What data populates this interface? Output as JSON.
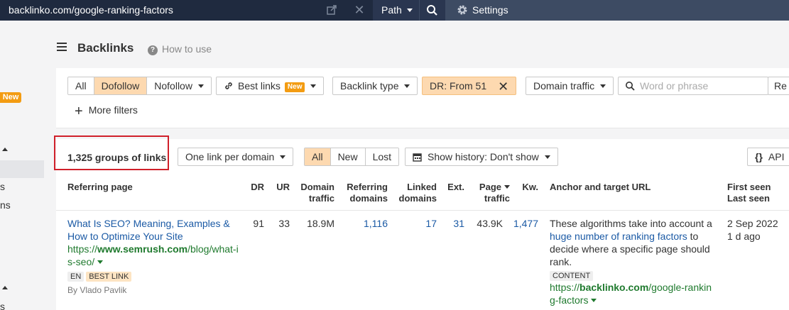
{
  "topbar": {
    "url": "backlinko.com/google-ranking-factors",
    "mode": "Path",
    "settings": "Settings",
    "icons": [
      "external-link-icon",
      "clear-icon",
      "search-icon",
      "gear-icon"
    ]
  },
  "sidebar": {
    "new_badge": "New",
    "item_a": "s",
    "item_b": "ns",
    "item_c": "s"
  },
  "header": {
    "title": "Backlinks",
    "how_to": "How to use",
    "help_glyph": "?"
  },
  "filters": {
    "all": "All",
    "dofollow": "Dofollow",
    "nofollow": "Nofollow",
    "best_links": "Best links",
    "best_links_badge": "New",
    "backlink_type": "Backlink type",
    "dr": "DR: From 51",
    "domain_traffic": "Domain traffic",
    "search_placeholder": "Word or phrase",
    "search_mode": "Re",
    "more_filters": "More filters"
  },
  "results": {
    "count": "1,325 groups of links",
    "grouping": "One link per domain",
    "tabs": [
      "All",
      "New",
      "Lost"
    ],
    "active_tab": "All",
    "history": "Show history: Don't show",
    "api": "{}",
    "api_label": "API"
  },
  "table": {
    "headers": {
      "referring_page": "Referring page",
      "dr": "DR",
      "ur": "UR",
      "domain_traffic_1": "Domain",
      "domain_traffic_2": "traffic",
      "referring_domains_1": "Referring",
      "referring_domains_2": "domains",
      "linked_domains_1": "Linked",
      "linked_domains_2": "domains",
      "ext": "Ext.",
      "page_traffic_1": "Page",
      "page_traffic_2": "traffic",
      "kw": "Kw.",
      "anchor": "Anchor and target URL",
      "first_seen": "First seen",
      "last_seen": "Last seen"
    },
    "rows": [
      {
        "title_line1": "What Is SEO? Meaning, Examples &",
        "title_line2": "How to Optimize Your Site",
        "url_prefix": "https://",
        "url_domain": "www.semrush.com",
        "url_path1": "/blog/what-i",
        "url_path2": "s-seo/",
        "lang": "EN",
        "badge": "BEST LINK",
        "author": "By Vlado Pavlik",
        "dr": "91",
        "ur": "33",
        "domain_traffic": "18.9M",
        "referring_domains": "1,116",
        "linked_domains": "17",
        "ext": "31",
        "page_traffic": "43.9K",
        "kw": "1,477",
        "anchor_pre": "These algorithms take into account a",
        "anchor_link1": "huge number of ranking factors",
        "anchor_post1": " to",
        "anchor_post2": "decide where a specific page should",
        "anchor_post3": "rank.",
        "anchor_tag": "CONTENT",
        "target_prefix": "https://",
        "target_domain": "backlinko.com",
        "target_path1": "/google-rankin",
        "target_path2": "g-factors",
        "first_seen": "2 Sep 2022",
        "last_seen": "1 d ago"
      }
    ]
  }
}
